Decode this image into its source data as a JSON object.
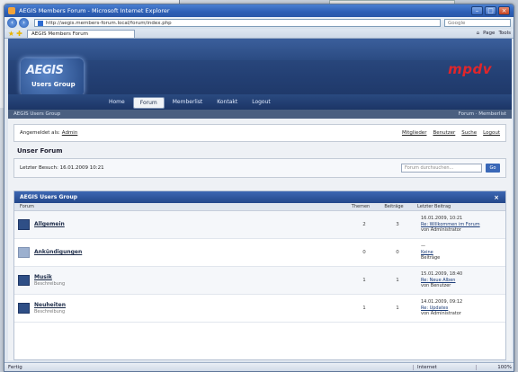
{
  "window": {
    "title": "AEGIS Members Forum - Microsoft Internet Explorer",
    "address": "http://aegis.members-forum.local/forum/index.php",
    "tab_label": "AEGIS Members Forum",
    "search_placeholder": "Google",
    "command_items": [
      "Page",
      "Tools"
    ]
  },
  "site": {
    "logo_big": "AEGIS",
    "logo_small": "Users Group",
    "brand_prefix": "mp",
    "brand_suffix": "dv",
    "menu": [
      "Home",
      "Forum",
      "Memberlist",
      "Kontakt",
      "Logout"
    ],
    "active_menu": 1,
    "crumb_left": "AEGIS Users Group",
    "crumb_right": "Forum · Memberlist"
  },
  "userbar": {
    "welcome": "Angemeldet als: ",
    "user": "Admin",
    "links": [
      "Mitglieder",
      "Benutzer",
      "Suche",
      "Logout"
    ]
  },
  "page": {
    "heading": "Unser Forum",
    "last_visit": "Letzter Besuch: 16.01.2009 10:21",
    "search_placeholder": "Forum durchsuchen...",
    "search_go": "Go"
  },
  "forum": {
    "section_title": "AEGIS Users Group",
    "close": "×",
    "columns": [
      "Forum",
      "Themen",
      "Beiträge",
      "Letzter Beitrag"
    ],
    "rows": [
      {
        "name": "Allgemein",
        "desc": "",
        "topics": "2",
        "posts": "3",
        "last1": "16.01.2009, 10:21",
        "last2": "Re: Willkommen im Forum",
        "last3": "von Administrator",
        "dim": false
      },
      {
        "name": "Ankündigungen",
        "desc": "",
        "topics": "0",
        "posts": "0",
        "last1": "—",
        "last2": "Keine",
        "last3": "Beiträge",
        "dim": true
      },
      {
        "name": "Musik",
        "desc": "Beschreibung",
        "topics": "1",
        "posts": "1",
        "last1": "15.01.2009, 18:40",
        "last2": "Re: Neue Alben",
        "last3": "von Benutzer",
        "dim": false
      },
      {
        "name": "Neuheiten",
        "desc": "Beschreibung",
        "topics": "1",
        "posts": "1",
        "last1": "14.01.2009, 09:12",
        "last2": "Re: Updates",
        "last3": "von Administrator",
        "dim": false
      }
    ]
  },
  "status": {
    "text": "Fertig",
    "zone": "Internet",
    "zoom": "100%"
  }
}
